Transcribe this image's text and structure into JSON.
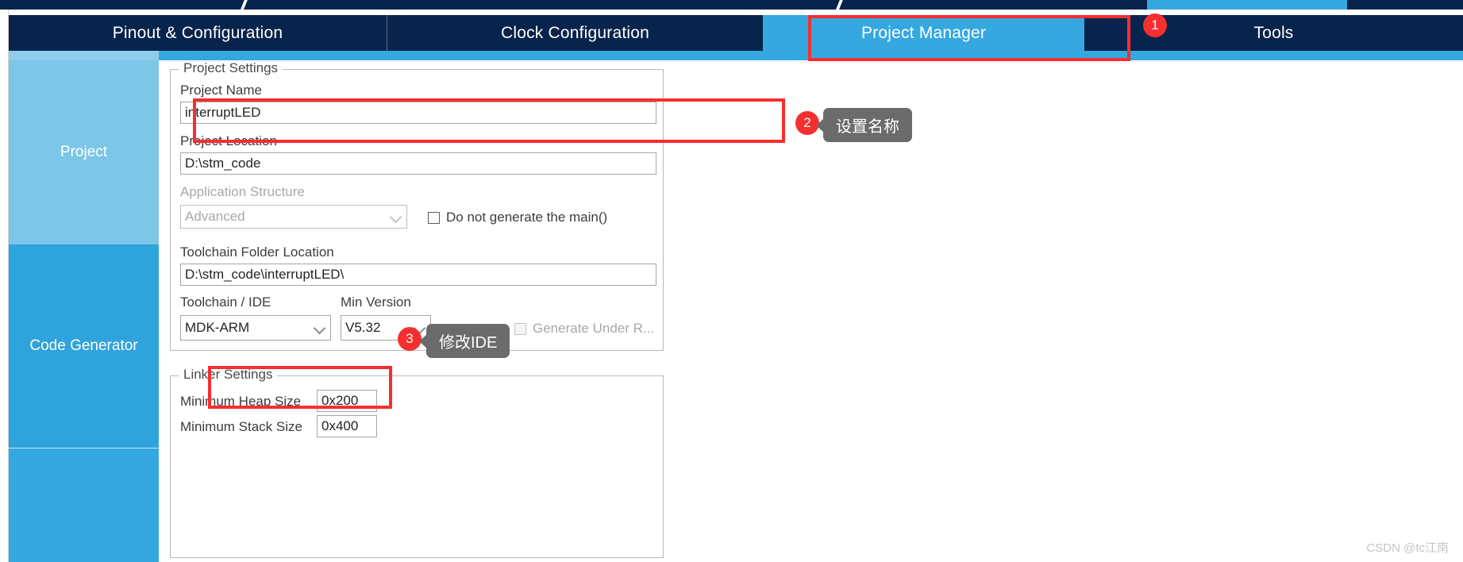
{
  "window": {
    "top_strip_note": "truncated toolbar row above tab bar"
  },
  "tabs": [
    {
      "label": "Pinout & Configuration",
      "selected": false
    },
    {
      "label": "Clock Configuration",
      "selected": false
    },
    {
      "label": "Project Manager",
      "selected": true
    },
    {
      "label": "Tools",
      "selected": false
    }
  ],
  "sidebar": {
    "items": [
      {
        "label": "Project",
        "selected": true
      },
      {
        "label": "Code Generator",
        "selected": false
      },
      {
        "label": "",
        "selected": false
      }
    ]
  },
  "project_settings": {
    "legend": "Project Settings",
    "project_name": {
      "label": "Project Name",
      "value": "interruptLED"
    },
    "project_location": {
      "label": "Project Location",
      "value": "D:\\stm_code"
    },
    "application_structure": {
      "label": "Application Structure",
      "value": "Advanced",
      "disabled": true
    },
    "do_not_generate_main": {
      "label": "Do not generate the main()",
      "checked": false
    },
    "toolchain_folder_location": {
      "label": "Toolchain Folder Location",
      "value": "D:\\stm_code\\interruptLED\\"
    },
    "toolchain_ide": {
      "label": "Toolchain / IDE",
      "value": "MDK-ARM"
    },
    "min_version": {
      "label": "Min Version",
      "value": "V5.32"
    },
    "generate_under_root": {
      "label": "Generate Under R...",
      "checked": false,
      "disabled": true
    }
  },
  "linker_settings": {
    "legend": "Linker Settings",
    "minimum_heap_size": {
      "label": "Minimum Heap Size",
      "value": "0x200"
    },
    "minimum_stack_size": {
      "label": "Minimum Stack Size",
      "value": "0x400"
    }
  },
  "annotations": {
    "badges": [
      {
        "number": "1"
      },
      {
        "number": "2"
      },
      {
        "number": "3"
      }
    ],
    "callouts": [
      {
        "text": "设置名称"
      },
      {
        "text": "修改IDE"
      }
    ],
    "highlight_color": "#f52f2f"
  },
  "watermark": {
    "text": "CSDN @tc江南"
  },
  "colors": {
    "navy": "#08244c",
    "accent_blue": "#35a8e0",
    "sidebar_selected": "#7cc6e8",
    "sidebar_normal": "#2fa3db",
    "callout_grey": "#6b6b6b"
  }
}
